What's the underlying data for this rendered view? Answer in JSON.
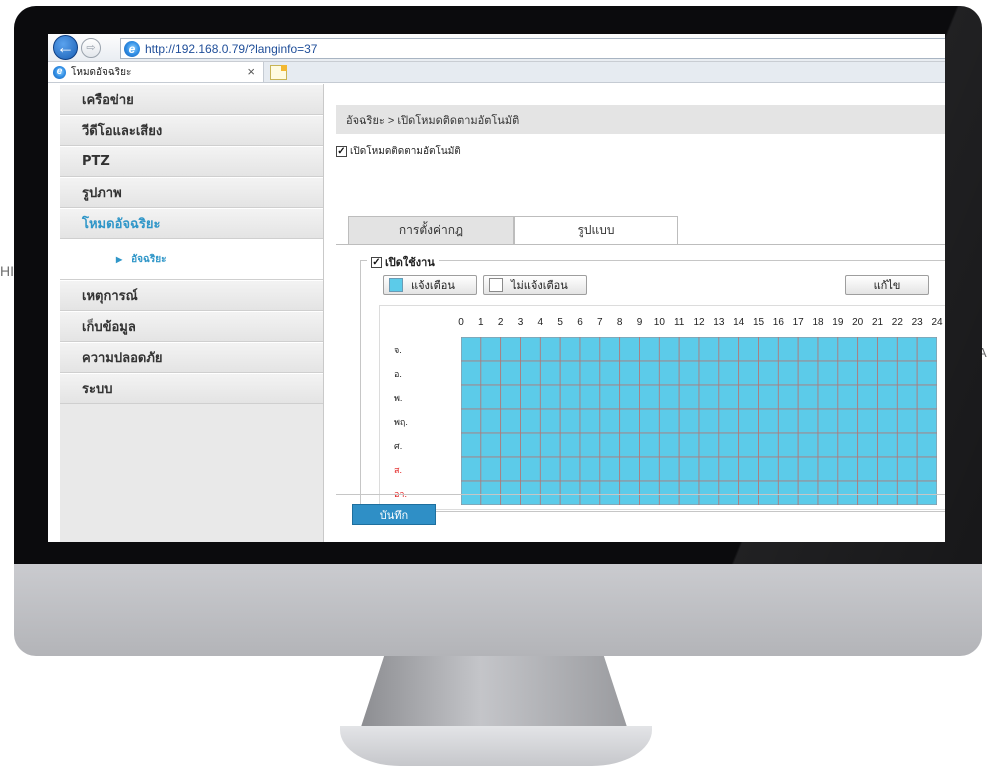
{
  "background_text": {
    "left": "HI R&",
    "right": "A"
  },
  "browser": {
    "url": "http://192.168.0.79/?langinfo=37",
    "tab_title": "โหมดอัจฉริยะ",
    "close_glyph": "×",
    "back_glyph": "←",
    "forward_glyph": "⇨",
    "ie_glyph": "e"
  },
  "sidebar": {
    "items": [
      {
        "label": "เครือข่าย"
      },
      {
        "label": "วีดีโอและเสียง"
      },
      {
        "label": "PTZ"
      },
      {
        "label": "รูปภาพ"
      },
      {
        "label": "โหมดอัจฉริยะ",
        "active": true
      },
      {
        "label": "เหตุการณ์"
      },
      {
        "label": "เก็บข้อมูล"
      },
      {
        "label": "ความปลอดภัย"
      },
      {
        "label": "ระบบ"
      }
    ],
    "sub_item": {
      "label": "อัจฉริยะ",
      "arrow": "▶"
    }
  },
  "main": {
    "breadcrumb": "อัจฉริยะ > เปิดโหมดติดตามอัตโนมัติ",
    "enable_auto_tracking": {
      "label": "เปิดโหมดติดตามอัตโนมัติ",
      "checked": true
    },
    "tabs": [
      {
        "label": "การตั้งค่ากฎ",
        "active": false
      },
      {
        "label": "รูปแบบ",
        "active": true
      }
    ],
    "schedule": {
      "enable_label": "เปิดใช้งาน",
      "enabled": true,
      "alarm_label": "แจ้งเตือน",
      "no_alarm_label": "ไม่แจ้งเตือน",
      "edit_label": "แก้ไข",
      "hours": [
        "0",
        "1",
        "2",
        "3",
        "4",
        "5",
        "6",
        "7",
        "8",
        "9",
        "10",
        "11",
        "12",
        "13",
        "14",
        "15",
        "16",
        "17",
        "18",
        "19",
        "20",
        "21",
        "22",
        "23",
        "24"
      ],
      "days": [
        {
          "label": "จ.",
          "weekend": false
        },
        {
          "label": "อ.",
          "weekend": false
        },
        {
          "label": "พ.",
          "weekend": false
        },
        {
          "label": "พฤ.",
          "weekend": false
        },
        {
          "label": "ศ.",
          "weekend": false
        },
        {
          "label": "ส.",
          "weekend": true
        },
        {
          "label": "อา.",
          "weekend": true
        }
      ],
      "all_cells_alarm": true,
      "alarm_color": "#5ccbe9",
      "grid_line_color": "#b07878"
    },
    "save_label": "บันทึก"
  },
  "colors": {
    "accent": "#2f96c8",
    "save_button": "#2f8fc6",
    "weekend_text": "#e01818"
  }
}
